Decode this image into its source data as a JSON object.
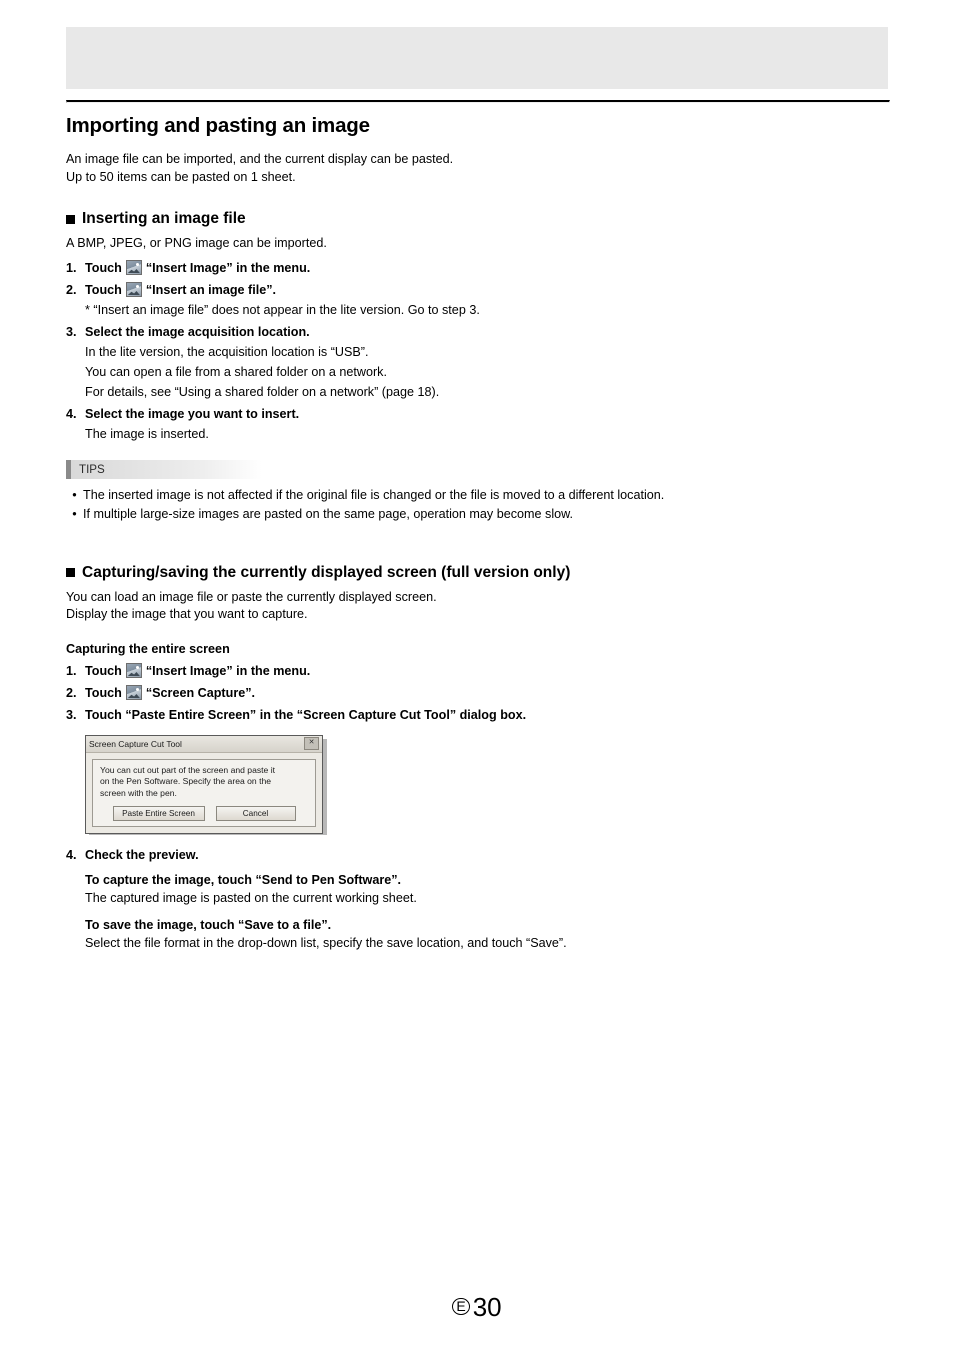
{
  "page": {
    "title": "Importing and pasting an image",
    "intro_lines": [
      "An image file can be imported, and the current display can be pasted.",
      "Up to 50 items can be pasted on 1 sheet."
    ],
    "footer_mark": "E",
    "footer_number": "30"
  },
  "section1": {
    "heading": "Inserting an image file",
    "lead": "A BMP, JPEG, or PNG image can be imported.",
    "steps": [
      {
        "num": "1.",
        "pre": "Touch",
        "icon": "insert-image-icon",
        "post": "“Insert Image” in the menu.",
        "sub": []
      },
      {
        "num": "2.",
        "pre": "Touch",
        "icon": "insert-image-file-icon",
        "post": "“Insert an image file”.",
        "sub": [
          "* “Insert an image file” does not appear in the lite version. Go to step 3."
        ]
      },
      {
        "num": "3.",
        "pre": "",
        "icon": "",
        "post": "Select the image acquisition location.",
        "sub": [
          "In the lite version, the acquisition location is “USB”.",
          "You can open a file from a shared folder on a network.",
          "For details, see “Using a shared folder on a network” (page 18)."
        ]
      },
      {
        "num": "4.",
        "pre": "",
        "icon": "",
        "post": "Select the image you want to insert.",
        "sub": [
          "The image is inserted."
        ]
      }
    ],
    "tips_label": "TIPS",
    "tips": [
      "The inserted image is not affected if the original file is changed or the file is moved to a different location.",
      "If multiple large-size images are pasted on the same page, operation may become slow."
    ]
  },
  "section2": {
    "heading": "Capturing/saving the currently displayed screen (full version only)",
    "lead_lines": [
      "You can load an image file or paste the currently displayed screen.",
      "Display the image that you want to capture."
    ],
    "subheading": "Capturing the entire screen",
    "steps": [
      {
        "num": "1.",
        "pre": "Touch",
        "icon": "insert-image-icon",
        "post": "“Insert Image” in the menu."
      },
      {
        "num": "2.",
        "pre": "Touch",
        "icon": "screen-capture-icon",
        "post": "“Screen Capture”."
      },
      {
        "num": "3.",
        "pre": "",
        "icon": "",
        "post": "Touch “Paste Entire Screen” in the “Screen Capture Cut Tool” dialog box."
      }
    ],
    "dialog": {
      "title": "Screen Capture Cut Tool",
      "close_label": "✕",
      "body_lines": [
        "You can cut out part of the screen and paste it",
        "on the Pen Software. Specify the area on the",
        "screen with the pen."
      ],
      "paste_button": "Paste Entire Screen",
      "cancel_button": "Cancel"
    },
    "step4": {
      "num": "4.",
      "label": "Check the preview."
    },
    "after": [
      {
        "bold": "To capture the image, touch “Send to Pen Software”.",
        "plain": "The captured image is pasted on the current working sheet."
      },
      {
        "bold": "To save the image, touch “Save to a file”.",
        "plain": "Select the file format in the drop-down list, specify the save location, and touch “Save”."
      }
    ]
  }
}
